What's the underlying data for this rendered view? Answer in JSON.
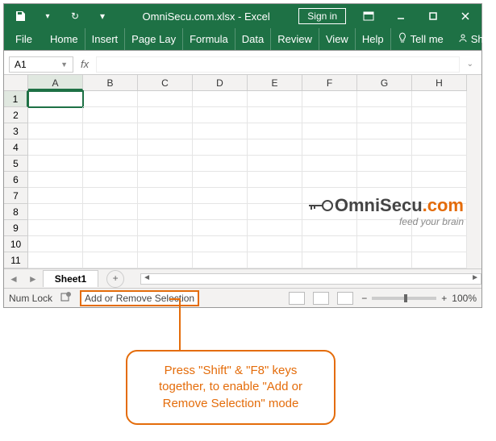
{
  "titlebar": {
    "title": "OmniSecu.com.xlsx  -  Excel",
    "signin": "Sign in"
  },
  "ribbon": {
    "file": "File",
    "tabs": [
      "Home",
      "Insert",
      "Page Lay",
      "Formula",
      "Data",
      "Review",
      "View",
      "Help"
    ],
    "tellme": "Tell me",
    "share": "Share"
  },
  "formula": {
    "namebox": "A1",
    "fx": "fx"
  },
  "columns": [
    "A",
    "B",
    "C",
    "D",
    "E",
    "F",
    "G",
    "H"
  ],
  "rows": [
    "1",
    "2",
    "3",
    "4",
    "5",
    "6",
    "7",
    "8",
    "9",
    "10",
    "11"
  ],
  "active_cell": "A1",
  "sheet": {
    "name": "Sheet1",
    "add": "+"
  },
  "status": {
    "numlock": "Num Lock",
    "mode": "Add or Remove Selection",
    "zoom": "100%",
    "minus": "−",
    "plus": "+"
  },
  "watermark": {
    "line1a": "OmniSecu",
    "line1b": ".com",
    "line2": "feed your brain"
  },
  "callout": {
    "text": "Press \"Shift\" & \"F8\" keys together,  to enable \"Add or Remove Selection\" mode"
  }
}
